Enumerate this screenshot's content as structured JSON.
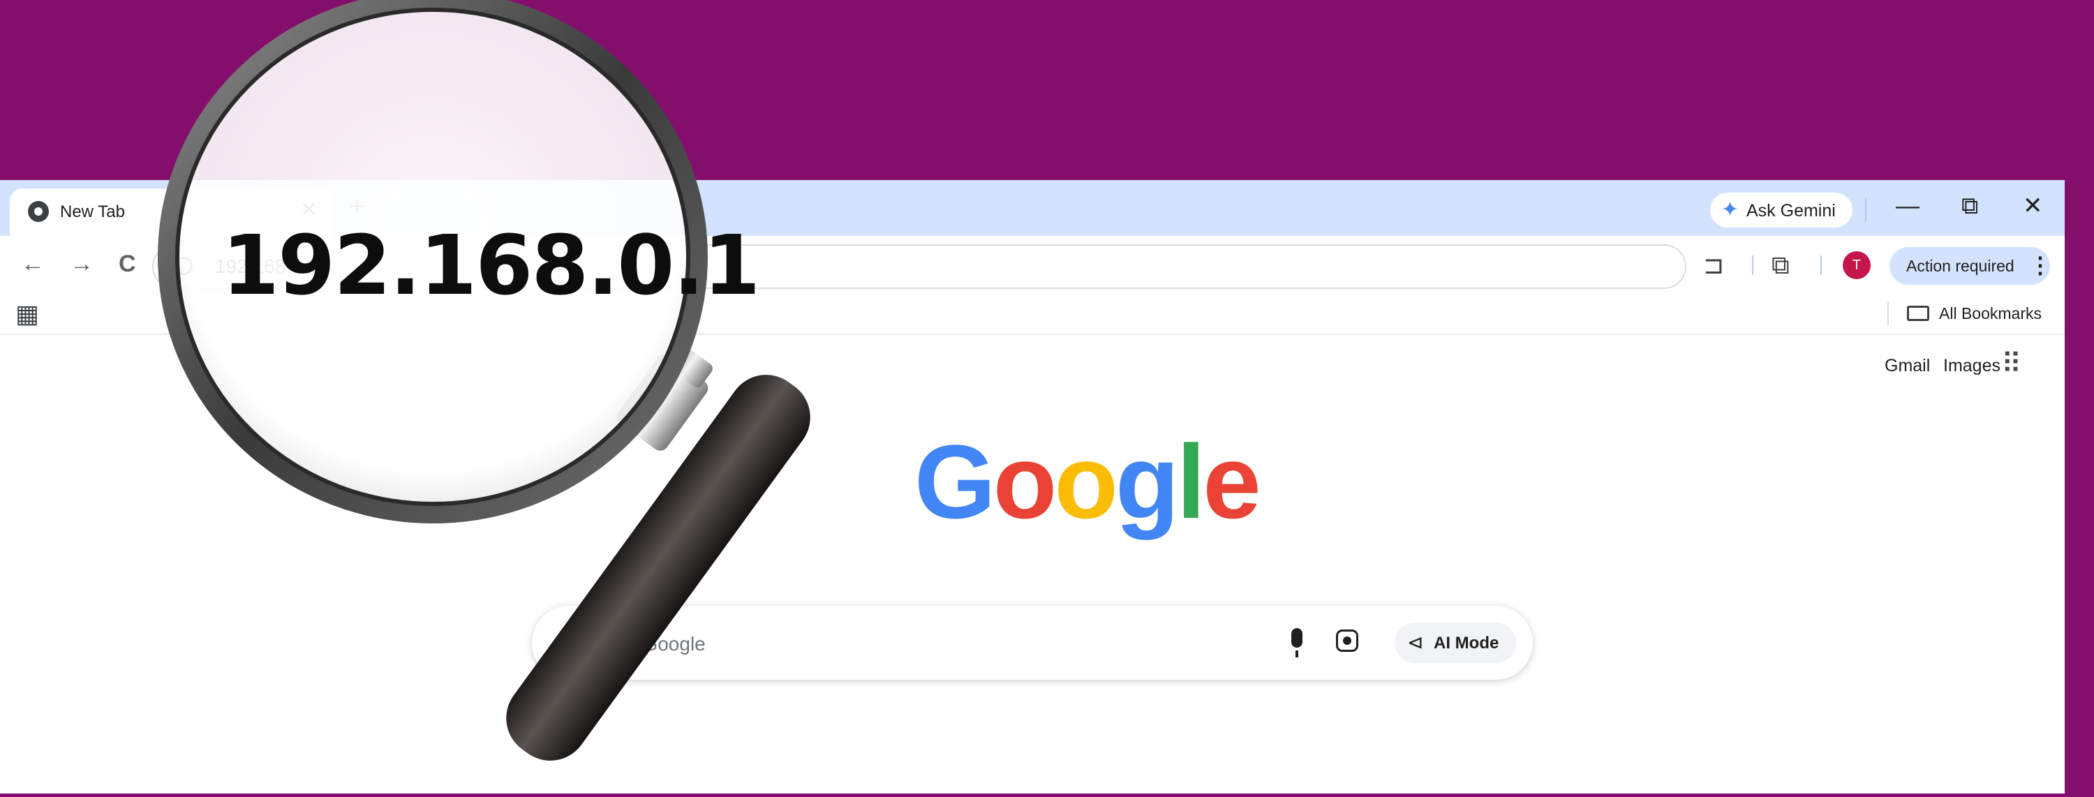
{
  "tab": {
    "title": "New Tab",
    "close_icon": "close-icon",
    "favicon": "chrome-icon"
  },
  "newtab": {
    "label": "+"
  },
  "gemini": {
    "label": "Ask Gemini",
    "icon": "gemini-star-icon"
  },
  "window_controls": {
    "minimize": "—",
    "restore": "⧉",
    "close": "✕"
  },
  "nav": {
    "back": "←",
    "forward": "→",
    "reload": "C"
  },
  "omnibox": {
    "text": "192.168.0.1"
  },
  "toolbar": {
    "extensions": "⊐",
    "reading_list": "⧉",
    "avatar_letter": "T"
  },
  "action_required": {
    "label": "Action required",
    "menu": "⋮"
  },
  "bookmarks": {
    "apps_icon": "▦",
    "all_label": "All Bookmarks"
  },
  "content": {
    "gmail": "Gmail",
    "images": "Images",
    "apps_grid": "⠿",
    "logo_letters": [
      "G",
      "o",
      "o",
      "g",
      "l",
      "e"
    ],
    "logo_colors": [
      "#4285f4",
      "#ea4335",
      "#fbbc05",
      "#4285f4",
      "#34a853",
      "#ea4335"
    ]
  },
  "search": {
    "plus": "+",
    "placeholder": "Ask Google",
    "ai_mode_label": "AI Mode",
    "ai_icon": "⊲"
  },
  "magnifier": {
    "zoom_text": "192.168.0.1"
  },
  "colors": {
    "background": "#840e6c",
    "tabstrip": "#d3e3fd",
    "avatar": "#c5154a"
  }
}
